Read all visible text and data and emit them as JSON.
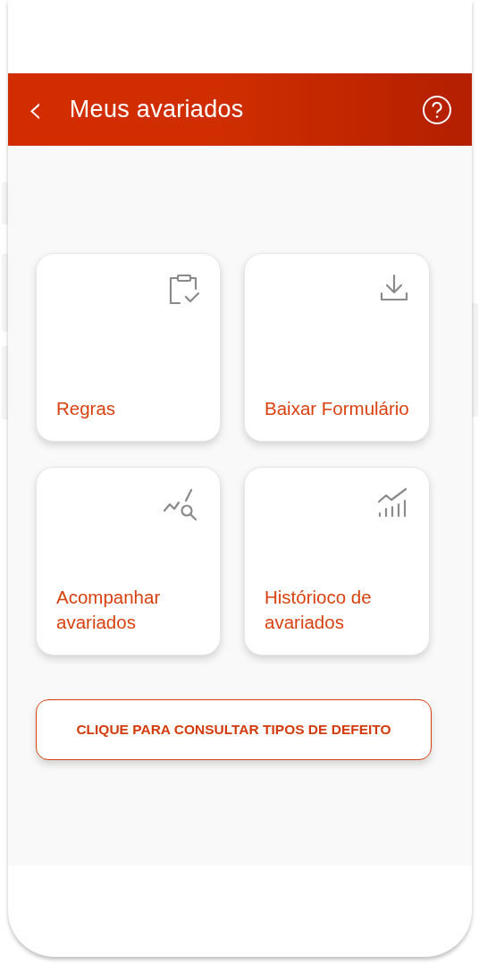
{
  "header": {
    "back": "‹",
    "title": "Meus avariados"
  },
  "tiles": [
    {
      "label": "Regras"
    },
    {
      "label": "Baixar Formulário"
    },
    {
      "label": "Acompanhar avariados"
    },
    {
      "label": "Histórioco de avariados"
    }
  ],
  "defect_button": {
    "label": "CLIQUE PARA CONSULTAR TIPOS DE DEFEITO"
  }
}
